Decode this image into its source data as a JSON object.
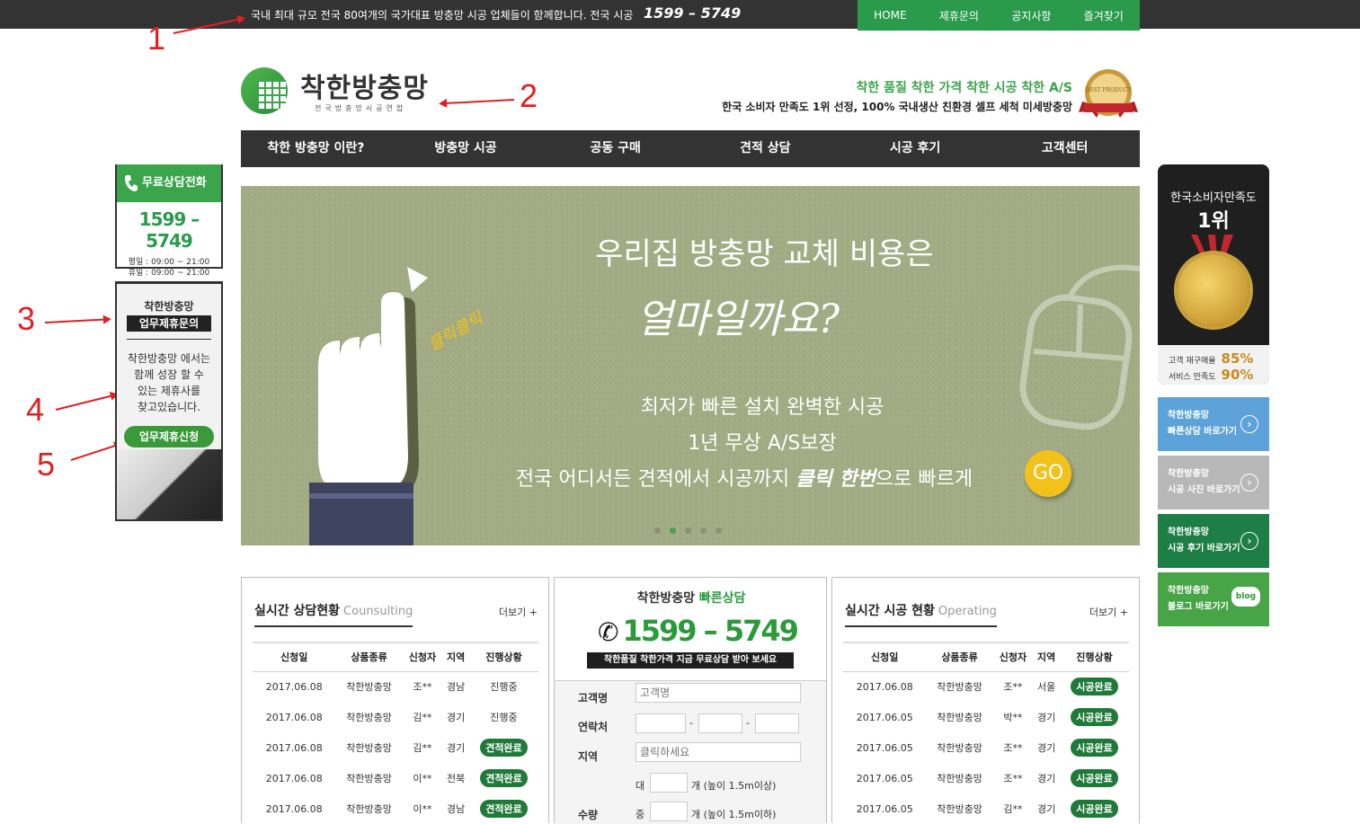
{
  "topbar": {
    "message": "국내 최대 규모 전국 80여개의 국가대표 방충망 시공 업체들이 함께합니다. 전국 시공",
    "phone": "1599 – 5749",
    "nav": [
      "HOME",
      "제휴문의",
      "공지사항",
      "즐겨찾기"
    ]
  },
  "annotations": [
    "1",
    "2",
    "3",
    "4",
    "5"
  ],
  "header": {
    "logo_name": "착한방충망",
    "logo_sub": "전국방충망시공연합",
    "slogan1": "착한 품질 착한 가격 착한 시공 착한 A/S",
    "slogan2": "한국 소비자 만족도 1위 선정, 100% 국내생산 친환경 셀프 세척 미세방충망",
    "badge": "BEST PRODUCT"
  },
  "main_nav": [
    "착한 방충망 이란?",
    "방충망 시공",
    "공동 구매",
    "견적 상담",
    "시공 후기",
    "고객센터"
  ],
  "banner": {
    "headline": "우리집 방충망 교체 비용은",
    "script": "얼마일까요?",
    "click_text": "클릭클릭",
    "line1": "최저가 빠른 설치 완벽한 시공",
    "line2": "1년 무상 A/S보장",
    "line3a": "전국 어디서든 견적에서 시공까지 ",
    "line3b": "클릭 한번",
    "line3c": "으로 빠르게",
    "go": "GO",
    "slide_count": 5,
    "active_slide": 2
  },
  "left_call": {
    "title": "무료상담전화",
    "phone": "1599 – 5749",
    "weekday": "평일 : 09:00 ~ 21:00",
    "holiday": "휴일 : 09:00 ~ 21:00"
  },
  "partner": {
    "title": "착한방충망",
    "subtitle": "업무제휴문의",
    "desc1": "착한방충망 에서는",
    "desc2": "함께 성장 할 수",
    "desc3": "있는 제휴사를",
    "desc4": "찾고있습니다.",
    "button": "업무제휴신청"
  },
  "right_badge": {
    "line1": "한국소비자만족도",
    "line2": "1위",
    "stat1_label": "고객 재구매율",
    "stat1_value": "85%",
    "stat2_label": "서비스 만족도",
    "stat2_value": "90%"
  },
  "right_buttons": [
    {
      "line1": "착한방충망",
      "line2": "빠른상담 바로가기",
      "color": "#5da3d9"
    },
    {
      "line1": "착한방충망",
      "line2": "시공 사진 바로가기",
      "color": "#b8b8b8"
    },
    {
      "line1": "착한방충망",
      "line2": "시공 후기 바로가기",
      "color": "#1d7e46"
    },
    {
      "line1": "착한방충망",
      "line2": "블로그 바로가기",
      "color": "#47a447",
      "badge": "blog"
    }
  ],
  "consult": {
    "title": "실시간 상담현황",
    "title_en": "Counsulting",
    "more": "더보기 +",
    "headers": [
      "신청일",
      "상품종류",
      "신청자",
      "지역",
      "진행상황"
    ],
    "rows": [
      [
        "2017.06.08",
        "착한방충망",
        "조**",
        "경남",
        "진행중"
      ],
      [
        "2017.06.08",
        "착한방충망",
        "김**",
        "경기",
        "진행중"
      ],
      [
        "2017.06.08",
        "착한방충망",
        "김**",
        "경기",
        "견적완료"
      ],
      [
        "2017.06.08",
        "착한방충망",
        "이**",
        "전북",
        "견적완료"
      ],
      [
        "2017.06.08",
        "착한방충망",
        "이**",
        "경남",
        "견적완료"
      ]
    ]
  },
  "quick": {
    "title_a": "착한방충망 ",
    "title_b": "빠른상담",
    "phone": "1599 – 5749",
    "bar": "착한품질 착한가격 지금 무료상담 받아 보세요",
    "label_name": "고객명",
    "placeholder_name": "고객명",
    "label_contact": "연락처",
    "label_region": "지역",
    "placeholder_region": "클릭하세요",
    "label_qty": "수량",
    "dash": "-",
    "large": "대",
    "large_note": "개 (높이 1.5m이상)",
    "medium": "중",
    "medium_note": "개 (높이 1.5m이하)"
  },
  "operating": {
    "title": "실시간 시공 현황",
    "title_en": "Operating",
    "more": "더보기 +",
    "headers": [
      "신청일",
      "상품종류",
      "신청자",
      "지역",
      "진행상황"
    ],
    "rows": [
      [
        "2017.06.08",
        "착한방충망",
        "조**",
        "서울",
        "시공완료"
      ],
      [
        "2017.06.05",
        "착한방충망",
        "박**",
        "경기",
        "시공완료"
      ],
      [
        "2017.06.05",
        "착한방충망",
        "조**",
        "경기",
        "시공완료"
      ],
      [
        "2017.06.05",
        "착한방충망",
        "조**",
        "경기",
        "시공완료"
      ],
      [
        "2017.06.05",
        "착한방충망",
        "김**",
        "경기",
        "시공완료"
      ]
    ]
  }
}
